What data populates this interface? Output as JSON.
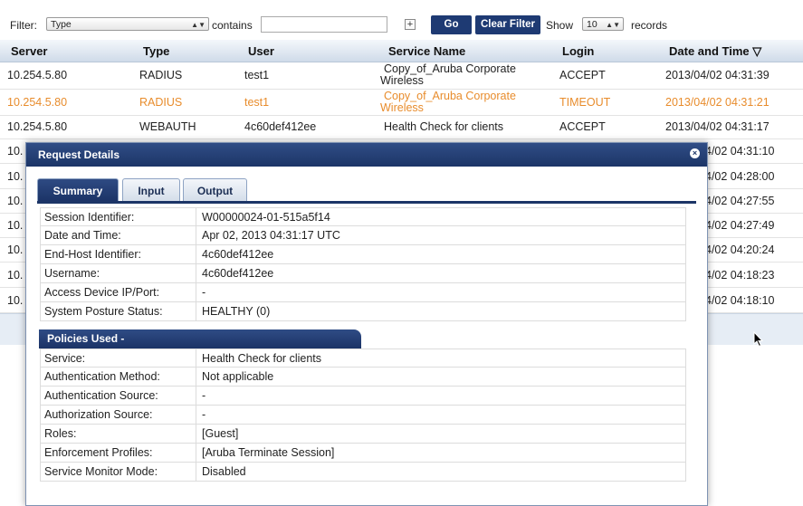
{
  "filter": {
    "label": "Filter:",
    "field_value": "Type",
    "contains_label": "contains",
    "text_value": "",
    "go_label": "Go",
    "clear_label": "Clear Filter",
    "show_label": "Show",
    "records_count": "10",
    "records_label": "records"
  },
  "table": {
    "headers": [
      "Server",
      "Type",
      "User",
      "Service Name",
      "Login",
      "Date and Time ▽"
    ],
    "rows": [
      {
        "server": "10.254.5.80",
        "type": "RADIUS",
        "user": "test1",
        "service": "Copy_of_Aruba Corporate Wireless",
        "login": "ACCEPT",
        "datetime": "2013/04/02 04:31:39"
      },
      {
        "server": "10.254.5.80",
        "type": "RADIUS",
        "user": "test1",
        "service": "Copy_of_Aruba Corporate Wireless",
        "login": "TIMEOUT",
        "datetime": "2013/04/02 04:31:21"
      },
      {
        "server": "10.254.5.80",
        "type": "WEBAUTH",
        "user": "4c60def412ee",
        "service": "Health Check for clients",
        "login": "ACCEPT",
        "datetime": "2013/04/02 04:31:17"
      },
      {
        "server": "10.",
        "datetime": "4/02 04:31:10"
      },
      {
        "server": "10.",
        "datetime": "4/02 04:28:00"
      },
      {
        "server": "10.",
        "datetime": "4/02 04:27:55"
      },
      {
        "server": "10.",
        "datetime": "4/02 04:27:49"
      },
      {
        "server": "10.",
        "datetime": "4/02 04:20:24"
      },
      {
        "server": "10.",
        "datetime": "4/02 04:18:23"
      },
      {
        "server": "10.",
        "datetime": "4/02 04:18:10"
      }
    ]
  },
  "dialog": {
    "title": "Request Details",
    "close_icon": "close-icon",
    "tabs": [
      "Summary",
      "Input",
      "Output"
    ],
    "active_tab": "Summary",
    "summary": [
      {
        "key": "Session Identifier:",
        "value": "W00000024-01-515a5f14"
      },
      {
        "key": "Date and Time:",
        "value": "Apr 02, 2013 04:31:17 UTC"
      },
      {
        "key": "End-Host Identifier:",
        "value": "4c60def412ee"
      },
      {
        "key": "Username:",
        "value": "4c60def412ee"
      },
      {
        "key": "Access Device IP/Port:",
        "value": "-"
      },
      {
        "key": "System Posture Status:",
        "value": "HEALTHY (0)"
      }
    ],
    "policies_title": "Policies Used -",
    "policies": [
      {
        "key": "Service:",
        "value": "Health Check for clients"
      },
      {
        "key": "Authentication Method:",
        "value": "Not applicable"
      },
      {
        "key": "Authentication Source:",
        "value": "-"
      },
      {
        "key": "Authorization Source:",
        "value": "-"
      },
      {
        "key": "Roles:",
        "value": "[Guest]"
      },
      {
        "key": "Enforcement Profiles:",
        "value": "[Aruba Terminate Session]"
      },
      {
        "key": "Service Monitor Mode:",
        "value": "Disabled"
      }
    ]
  },
  "colors": {
    "timeout": "#e88c2c",
    "header_navy": "#1c3567"
  }
}
